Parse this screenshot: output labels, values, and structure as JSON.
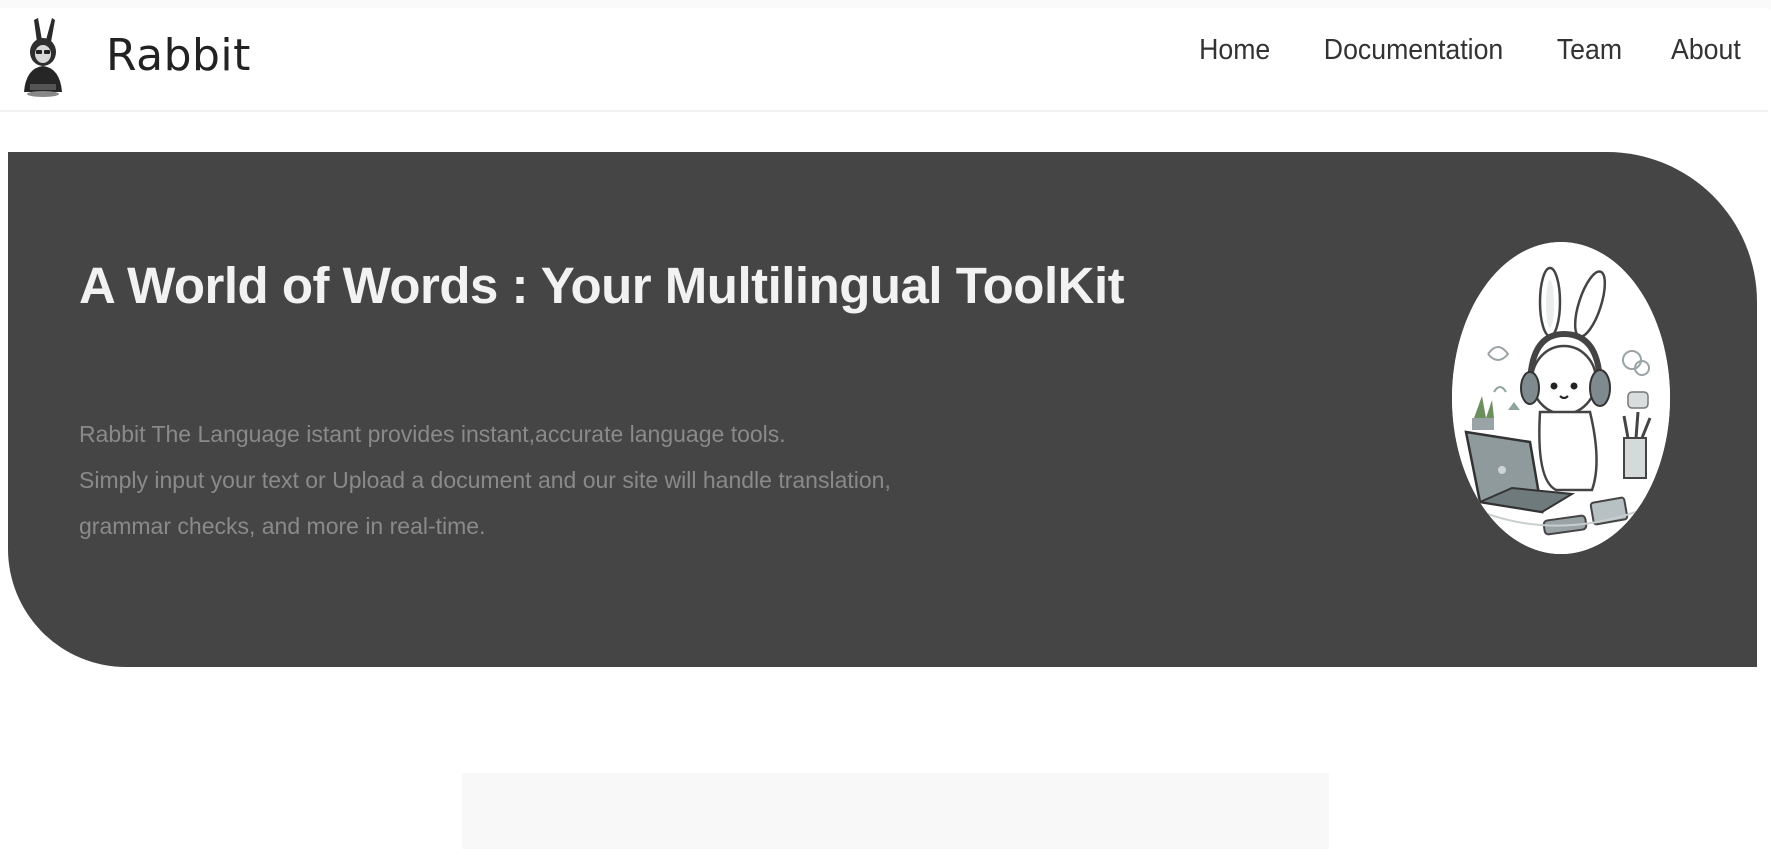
{
  "brand": {
    "name": "Rabbit",
    "logo_icon": "rabbit-hacker-icon"
  },
  "nav": {
    "items": [
      {
        "label": "Home"
      },
      {
        "label": "Documentation"
      },
      {
        "label": "Team"
      },
      {
        "label": "About"
      }
    ]
  },
  "hero": {
    "title": "A World of Words : Your Multilingual ToolKit",
    "description_lines": [
      "Rabbit The Language istant provides instant,accurate language tools.",
      "Simply input your text or Upload a document and our site will handle translation,",
      "grammar checks, and more in real-time."
    ],
    "illustration": "rabbit-with-headphones-laptop-illustration",
    "background_color": "#454545",
    "title_color": "#f2f2f2",
    "text_color": "#8a8a8a"
  }
}
